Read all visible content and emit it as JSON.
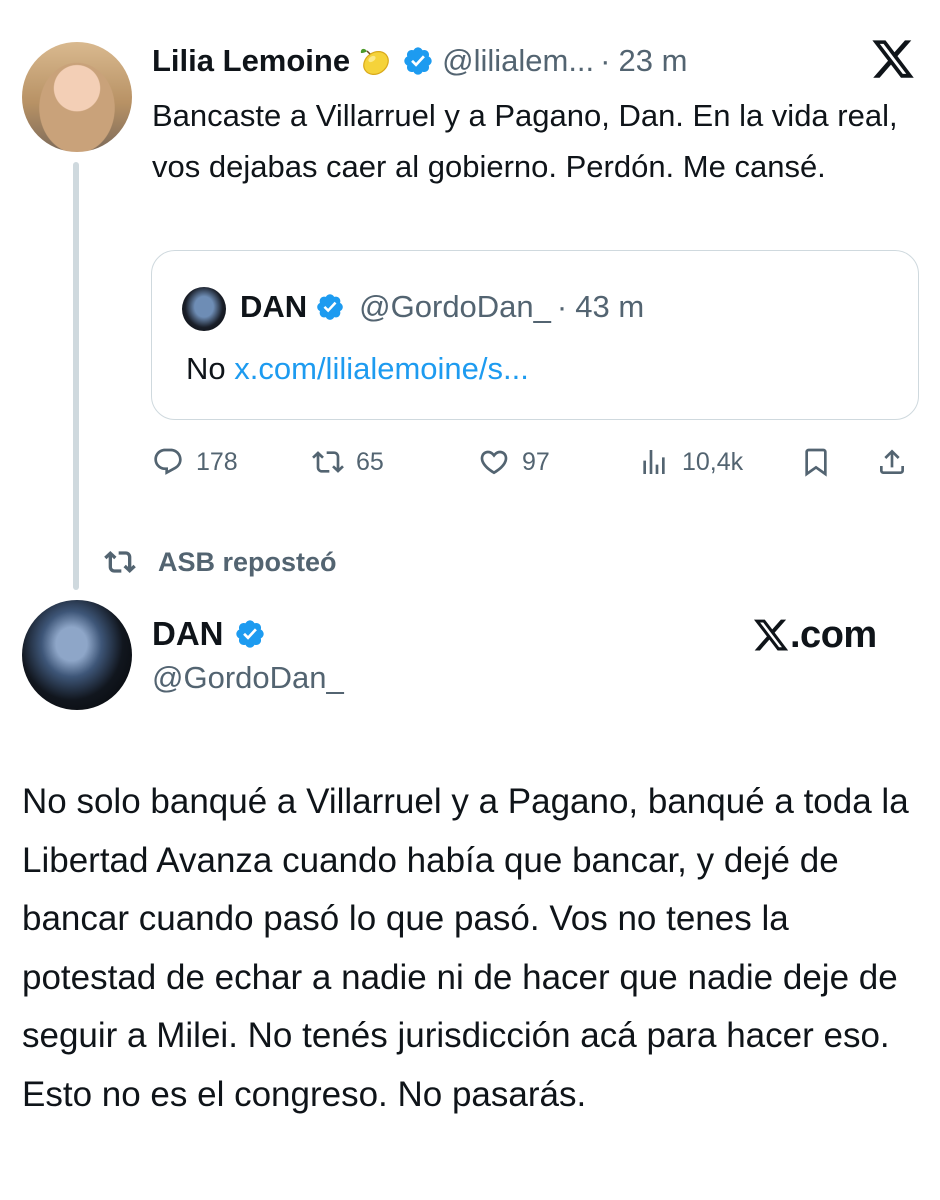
{
  "colors": {
    "text": "#0f1419",
    "secondary": "#536471",
    "link": "#1d9bf0",
    "verified": "#1d9bf0",
    "border": "#cfd9de"
  },
  "tweet1": {
    "author_name": "Lilia Lemoine",
    "name_emoji_icon": "lemon-icon",
    "handle": "@lilialem...",
    "separator": "·",
    "time": "23 m",
    "text": "Bancaste a Villarruel y a Pagano, Dan. En la vida real, vos dejabas caer al gobierno. Perdón. Me cansé.",
    "quoted": {
      "author_name": "DAN",
      "handle": "@GordoDan_",
      "separator": "·",
      "time": "43 m",
      "text": "No",
      "link": "x.com/lilialemoine/s..."
    },
    "stats": {
      "replies": "178",
      "reposts": "65",
      "likes": "97",
      "views": "10,4k"
    }
  },
  "repost_context": {
    "label": "ASB reposteó"
  },
  "tweet2": {
    "author_name": "DAN",
    "handle": "@GordoDan_",
    "brand": "X.com",
    "brand_suffix": ".com",
    "text": "No solo banqué a Villarruel y a Pagano, banqué a toda la Libertad Avanza cuando había que bancar, y dejé de bancar cuando pasó lo que pasó. Vos no tenes la potestad de echar a nadie ni de hacer que nadie deje de seguir a Milei. No tenés jurisdicción acá para hacer eso. Esto no es el congreso. No pasarás."
  }
}
